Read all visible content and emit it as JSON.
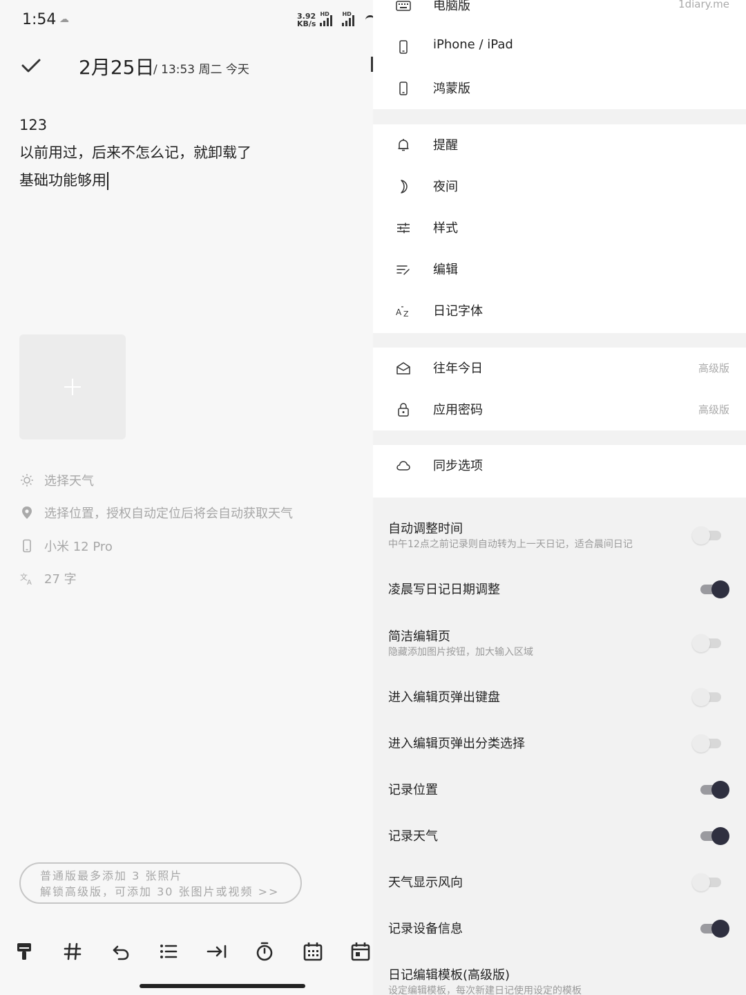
{
  "status_bar": {
    "time": "1:54",
    "net_speed_value": "3.92",
    "net_speed_unit": "KB/s",
    "hd_label": "HD"
  },
  "editor": {
    "date": "2月25日",
    "meta": "/ 13:53 周二 今天",
    "lines": [
      "123",
      "以前用过，后来不怎么记，就卸载了",
      "基础功能够用"
    ],
    "weather": "选择天气",
    "location": "选择位置，授权自动定位后将会自动获取天气",
    "device": "小米 12 Pro",
    "word_count": "27 字",
    "upgrade_line1": "普通版最多添加 3 张照片",
    "upgrade_line2": "解锁高级版，可添加 30 张图片或视频 >>"
  },
  "toolbar": {
    "icons": [
      "paint-brush-icon",
      "hash-icon",
      "undo-icon",
      "list-icon",
      "indent-icon",
      "timer-icon",
      "calendar-grid-icon",
      "calendar-icon"
    ]
  },
  "settings_menu": {
    "top_card": [
      {
        "label": "电脑版",
        "badge": "1diary.me",
        "icon": "keyboard-icon"
      },
      {
        "label": "iPhone / iPad",
        "badge": "",
        "icon": "phone-icon"
      },
      {
        "label": "鸿蒙版",
        "badge": "",
        "icon": "phone-icon"
      }
    ],
    "general_card": [
      {
        "label": "提醒",
        "icon": "bell-icon"
      },
      {
        "label": "夜间",
        "icon": "moon-icon"
      },
      {
        "label": "样式",
        "icon": "sliders-icon"
      },
      {
        "label": "编辑",
        "icon": "edit-lines-icon"
      },
      {
        "label": "日记字体",
        "icon": "font-az-icon"
      }
    ],
    "premium_card": [
      {
        "label": "往年今日",
        "badge": "高级版",
        "icon": "envelope-icon"
      },
      {
        "label": "应用密码",
        "badge": "高级版",
        "icon": "lock-icon"
      }
    ],
    "sync_card": [
      {
        "label": "同步选项",
        "icon": "cloud-icon"
      }
    ]
  },
  "toggles": [
    {
      "title": "自动调整时间",
      "subtitle": "中午12点之前记录则自动转为上一天日记，适合晨间日记",
      "on": false
    },
    {
      "title": "凌晨写日记日期调整",
      "subtitle": "",
      "on": true
    },
    {
      "title": "简洁编辑页",
      "subtitle": "隐藏添加图片按钮，加大输入区域",
      "on": false
    },
    {
      "title": "进入编辑页弹出键盘",
      "subtitle": "",
      "on": false
    },
    {
      "title": "进入编辑页弹出分类选择",
      "subtitle": "",
      "on": false
    },
    {
      "title": "记录位置",
      "subtitle": "",
      "on": true
    },
    {
      "title": "记录天气",
      "subtitle": "",
      "on": true
    },
    {
      "title": "天气显示风向",
      "subtitle": "",
      "on": false
    },
    {
      "title": "记录设备信息",
      "subtitle": "",
      "on": true
    },
    {
      "title": "日记编辑模板(高级版)",
      "subtitle": "设定编辑模板，每次新建日记使用设定的模板",
      "on": null
    }
  ],
  "colors": {
    "toggle_on_knob": "#2f3040",
    "toggle_on_track": "#9a9a9f",
    "toggle_off_track": "#d8d8d8",
    "muted_text": "#a7a7a7"
  }
}
